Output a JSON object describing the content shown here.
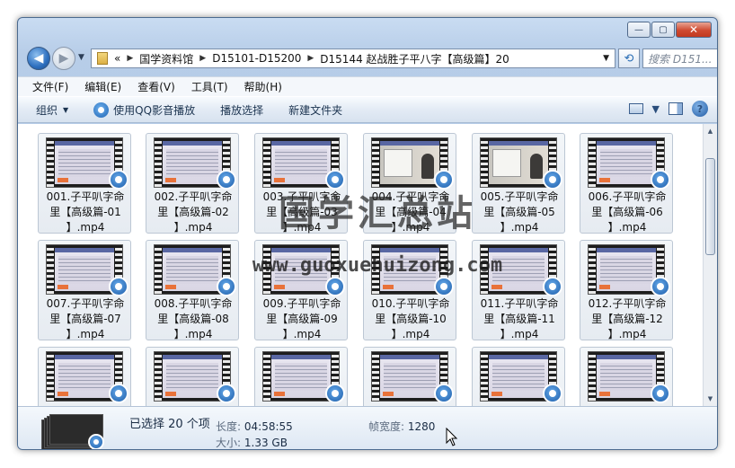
{
  "window": {
    "buttons": {
      "minimize": "—",
      "maximize": "▢",
      "close": "✕"
    }
  },
  "address": {
    "prefix": "«",
    "crumbs": [
      "国学资料馆",
      "D15101-D15200",
      "D15144 赵战胜子平八字【高级篇】20"
    ],
    "search_placeholder": "搜索 D151..."
  },
  "menu": [
    "文件(F)",
    "编辑(E)",
    "查看(V)",
    "工具(T)",
    "帮助(H)"
  ],
  "toolbar": {
    "organize": "组织",
    "play_qq": "使用QQ影音播放",
    "play_selection": "播放选择",
    "new_folder": "新建文件夹"
  },
  "items": [
    {
      "line1": "001.子平叭字命",
      "line2": "里【高级篇-01",
      "line3": "】.mp4"
    },
    {
      "line1": "002.子平叭字命",
      "line2": "里【高级篇-02",
      "line3": "】.mp4"
    },
    {
      "line1": "003.子平叭字命",
      "line2": "里【高级篇-03",
      "line3": "】.mp4"
    },
    {
      "line1": "004.子平叭字命",
      "line2": "里【高级篇-04",
      "line3": "】.mp4"
    },
    {
      "line1": "005.子平叭字命",
      "line2": "里【高级篇-05",
      "line3": "】.mp4"
    },
    {
      "line1": "006.子平叭字命",
      "line2": "里【高级篇-06",
      "line3": "】.mp4"
    },
    {
      "line1": "007.子平叭字命",
      "line2": "里【高级篇-07",
      "line3": "】.mp4"
    },
    {
      "line1": "008.子平叭字命",
      "line2": "里【高级篇-08",
      "line3": "】.mp4"
    },
    {
      "line1": "009.子平叭字命",
      "line2": "里【高级篇-09",
      "line3": "】.mp4"
    },
    {
      "line1": "010.子平叭字命",
      "line2": "里【高级篇-10",
      "line3": "】.mp4"
    },
    {
      "line1": "011.子平叭字命",
      "line2": "里【高级篇-11",
      "line3": "】.mp4"
    },
    {
      "line1": "012.子平叭字命",
      "line2": "里【高级篇-12",
      "line3": "】.mp4"
    },
    {
      "line1": "",
      "line2": "",
      "line3": ""
    },
    {
      "line1": "",
      "line2": "",
      "line3": ""
    },
    {
      "line1": "",
      "line2": "",
      "line3": ""
    },
    {
      "line1": "",
      "line2": "",
      "line3": ""
    },
    {
      "line1": "",
      "line2": "",
      "line3": ""
    },
    {
      "line1": "",
      "line2": "",
      "line3": ""
    }
  ],
  "watermark": {
    "cn": "国学汇总站",
    "url": "www.guoxuehuizong.com"
  },
  "details": {
    "selected": "已选择 20 个项",
    "length_label": "长度:",
    "length_value": "04:58:55",
    "size_label": "大小:",
    "size_value": "1.33 GB",
    "width_label": "帧宽度:",
    "width_value": "1280"
  }
}
